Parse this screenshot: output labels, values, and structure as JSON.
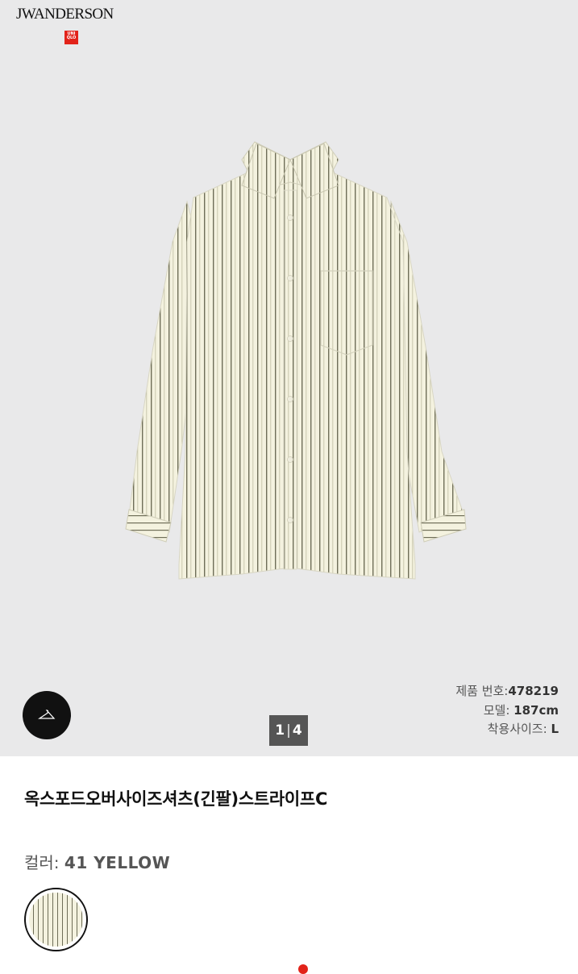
{
  "brand": {
    "name": "JWANDERSON",
    "partner_logo": "UNI QLO"
  },
  "pager": {
    "current": "1",
    "separator": "|",
    "total": "4"
  },
  "specs": {
    "product_no_label": "제품 번호:",
    "product_no_value": "478219",
    "model_label": "모델:",
    "model_value": "187cm",
    "size_label": "착용사이즈:",
    "size_value": "L"
  },
  "product": {
    "title": "옥스포드오버사이즈셔츠(긴팔)스트라이프C"
  },
  "color": {
    "label": "컬러:",
    "value": "41 YELLOW"
  },
  "icons": {
    "avatar_button": "hanger-icon",
    "swatch": "stripe-swatch"
  },
  "colors": {
    "hero_bg": "#e9e9ea",
    "shirt": "#f4f2df",
    "stripe": "#6f6e58",
    "accent": "#e2231a"
  }
}
